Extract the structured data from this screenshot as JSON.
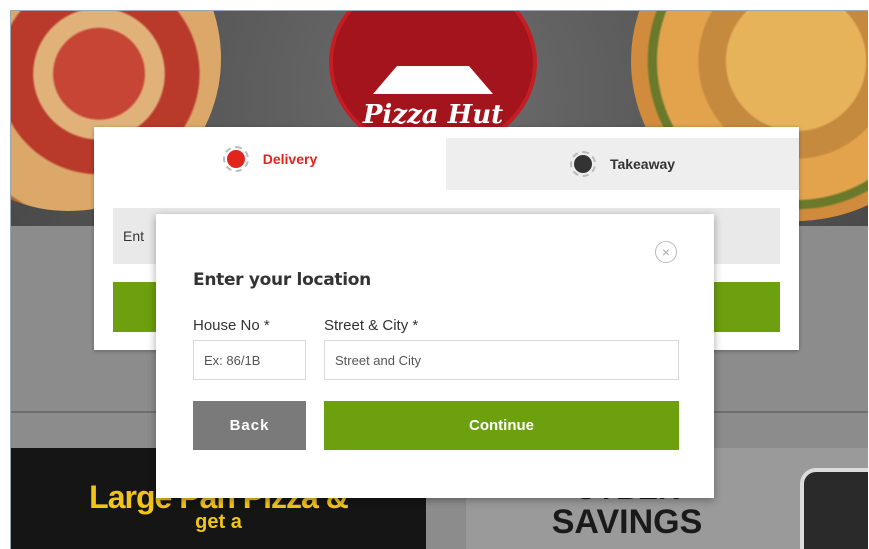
{
  "brand": {
    "logo_text": "Pizza Hut",
    "accent": "#e1251b",
    "green": "#6da00f"
  },
  "tabs": [
    {
      "label": "Delivery",
      "icon": "delivery-scooter-icon"
    },
    {
      "label": "Takeaway",
      "icon": "takeaway-bag-icon"
    }
  ],
  "order_panel": {
    "address_field_text": "Ent"
  },
  "modal": {
    "title": "Enter your location",
    "house": {
      "label": "House No *",
      "placeholder": "Ex: 86/1B"
    },
    "street": {
      "label": "Street & City *",
      "placeholder": "Street and City"
    },
    "back_label": "Back",
    "continue_label": "Continue",
    "close_symbol": "×"
  },
  "promos": {
    "left_line1": "Large Pan Pizza &",
    "left_line2": "get a",
    "right_line1": "CYBER",
    "right_line2": "SAVINGS"
  }
}
